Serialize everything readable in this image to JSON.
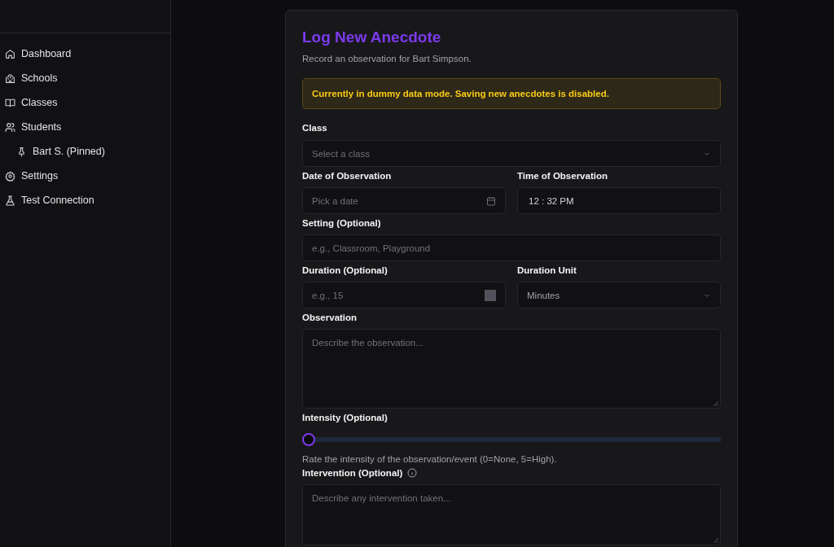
{
  "sidebar": {
    "items": [
      {
        "label": "Dashboard"
      },
      {
        "label": "Schools"
      },
      {
        "label": "Classes"
      },
      {
        "label": "Students",
        "children": [
          {
            "label": "Bart S. (Pinned)"
          }
        ]
      },
      {
        "label": "Settings"
      },
      {
        "label": "Test Connection"
      }
    ]
  },
  "form": {
    "title": "Log New Anecdote",
    "subtitle": "Record an observation for Bart Simpson.",
    "alert": "Currently in dummy data mode. Saving new anecdotes is disabled.",
    "rows": [
      [
        {
          "kind": "select",
          "label": "Class",
          "placeholder": "Select a class",
          "info": false
        }
      ],
      [
        {
          "kind": "date",
          "label": "Date of Observation",
          "placeholder": "Pick a date",
          "info": false
        },
        {
          "kind": "time",
          "label": "Time of Observation",
          "value": "12 : 32  PM",
          "info": false
        }
      ],
      [
        {
          "kind": "text",
          "label": "Setting (Optional)",
          "placeholder": "e.g., Classroom, Playground",
          "info": false
        }
      ],
      [
        {
          "kind": "number",
          "label": "Duration (Optional)",
          "placeholder": "e.g., 15",
          "info": false
        },
        {
          "kind": "select",
          "label": "Duration Unit",
          "value": "Minutes",
          "info": false
        }
      ],
      [
        {
          "kind": "textarea",
          "label": "Observation",
          "placeholder": "Describe the observation...",
          "info": false
        }
      ],
      [
        {
          "kind": "slider",
          "label": "Intensity (Optional)",
          "level": 0,
          "help": "Rate the intensity of the observation/event (0=None, 5=High).",
          "info": false
        }
      ],
      [
        {
          "kind": "textarea",
          "label": "Intervention (Optional)",
          "placeholder": "Describe any intervention taken...",
          "info": true
        }
      ]
    ]
  }
}
